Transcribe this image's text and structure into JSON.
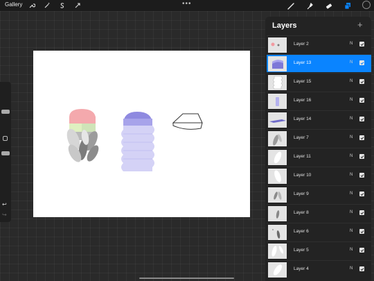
{
  "topbar": {
    "gallery_label": "Gallery",
    "left_tools": [
      "wrench-icon",
      "magic-wand-icon",
      "selection-s-icon",
      "arrow-transform-icon"
    ],
    "more_icon": "more-dots-icon",
    "right_tools": [
      "brush-icon",
      "smudge-icon",
      "eraser-icon",
      "layers-icon",
      "color-icon"
    ],
    "active_tool_color": "#0a84ff"
  },
  "sidebar": {
    "size_slider_level": 0.45,
    "opacity_slider_level": 0.35,
    "icons": [
      "modify-square-icon",
      "undo-icon",
      "redo-icon"
    ]
  },
  "canvas": {
    "background": "#ffffff",
    "objects": [
      "color-blocks-with-leaves",
      "purple-wavy-cylinder",
      "outline-block"
    ]
  },
  "layers": {
    "title": "Layers",
    "add_icon": "+",
    "items": [
      {
        "name": "Layer 2",
        "blend": "N",
        "visible": true,
        "active": false,
        "thumb": "dots"
      },
      {
        "name": "Layer 13",
        "blend": "N",
        "visible": true,
        "active": true,
        "thumb": "purple-top"
      },
      {
        "name": "Layer 15",
        "blend": "N",
        "visible": true,
        "active": false,
        "thumb": "wavy-column"
      },
      {
        "name": "Layer 16",
        "blend": "N",
        "visible": true,
        "active": false,
        "thumb": "purple-bar"
      },
      {
        "name": "Layer 14",
        "blend": "N",
        "visible": true,
        "active": false,
        "thumb": "flat-purple"
      },
      {
        "name": "Layer 7",
        "blend": "N",
        "visible": true,
        "active": false,
        "thumb": "gray-leaf"
      },
      {
        "name": "Layer 11",
        "blend": "N",
        "visible": true,
        "active": false,
        "thumb": "white-leaf"
      },
      {
        "name": "Layer 10",
        "blend": "N",
        "visible": true,
        "active": false,
        "thumb": "white-leaf-2"
      },
      {
        "name": "Layer 9",
        "blend": "N",
        "visible": true,
        "active": false,
        "thumb": "leaves-small"
      },
      {
        "name": "Layer 8",
        "blend": "N",
        "visible": true,
        "active": false,
        "thumb": "small-gray-leaf"
      },
      {
        "name": "Layer 6",
        "blend": "N",
        "visible": true,
        "active": false,
        "thumb": "dark-leaf"
      },
      {
        "name": "Layer 5",
        "blend": "N",
        "visible": true,
        "active": false,
        "thumb": "white-leaves"
      },
      {
        "name": "Layer 4",
        "blend": "N",
        "visible": true,
        "active": false,
        "thumb": "white-leaf-3"
      }
    ]
  },
  "colors": {
    "accent": "#0a84ff",
    "panel": "#232323",
    "purple": "#b8b6ee",
    "purple_dark": "#8f8ae0",
    "pink": "#f4a9ad",
    "yellow_green": "#dff0c0"
  }
}
